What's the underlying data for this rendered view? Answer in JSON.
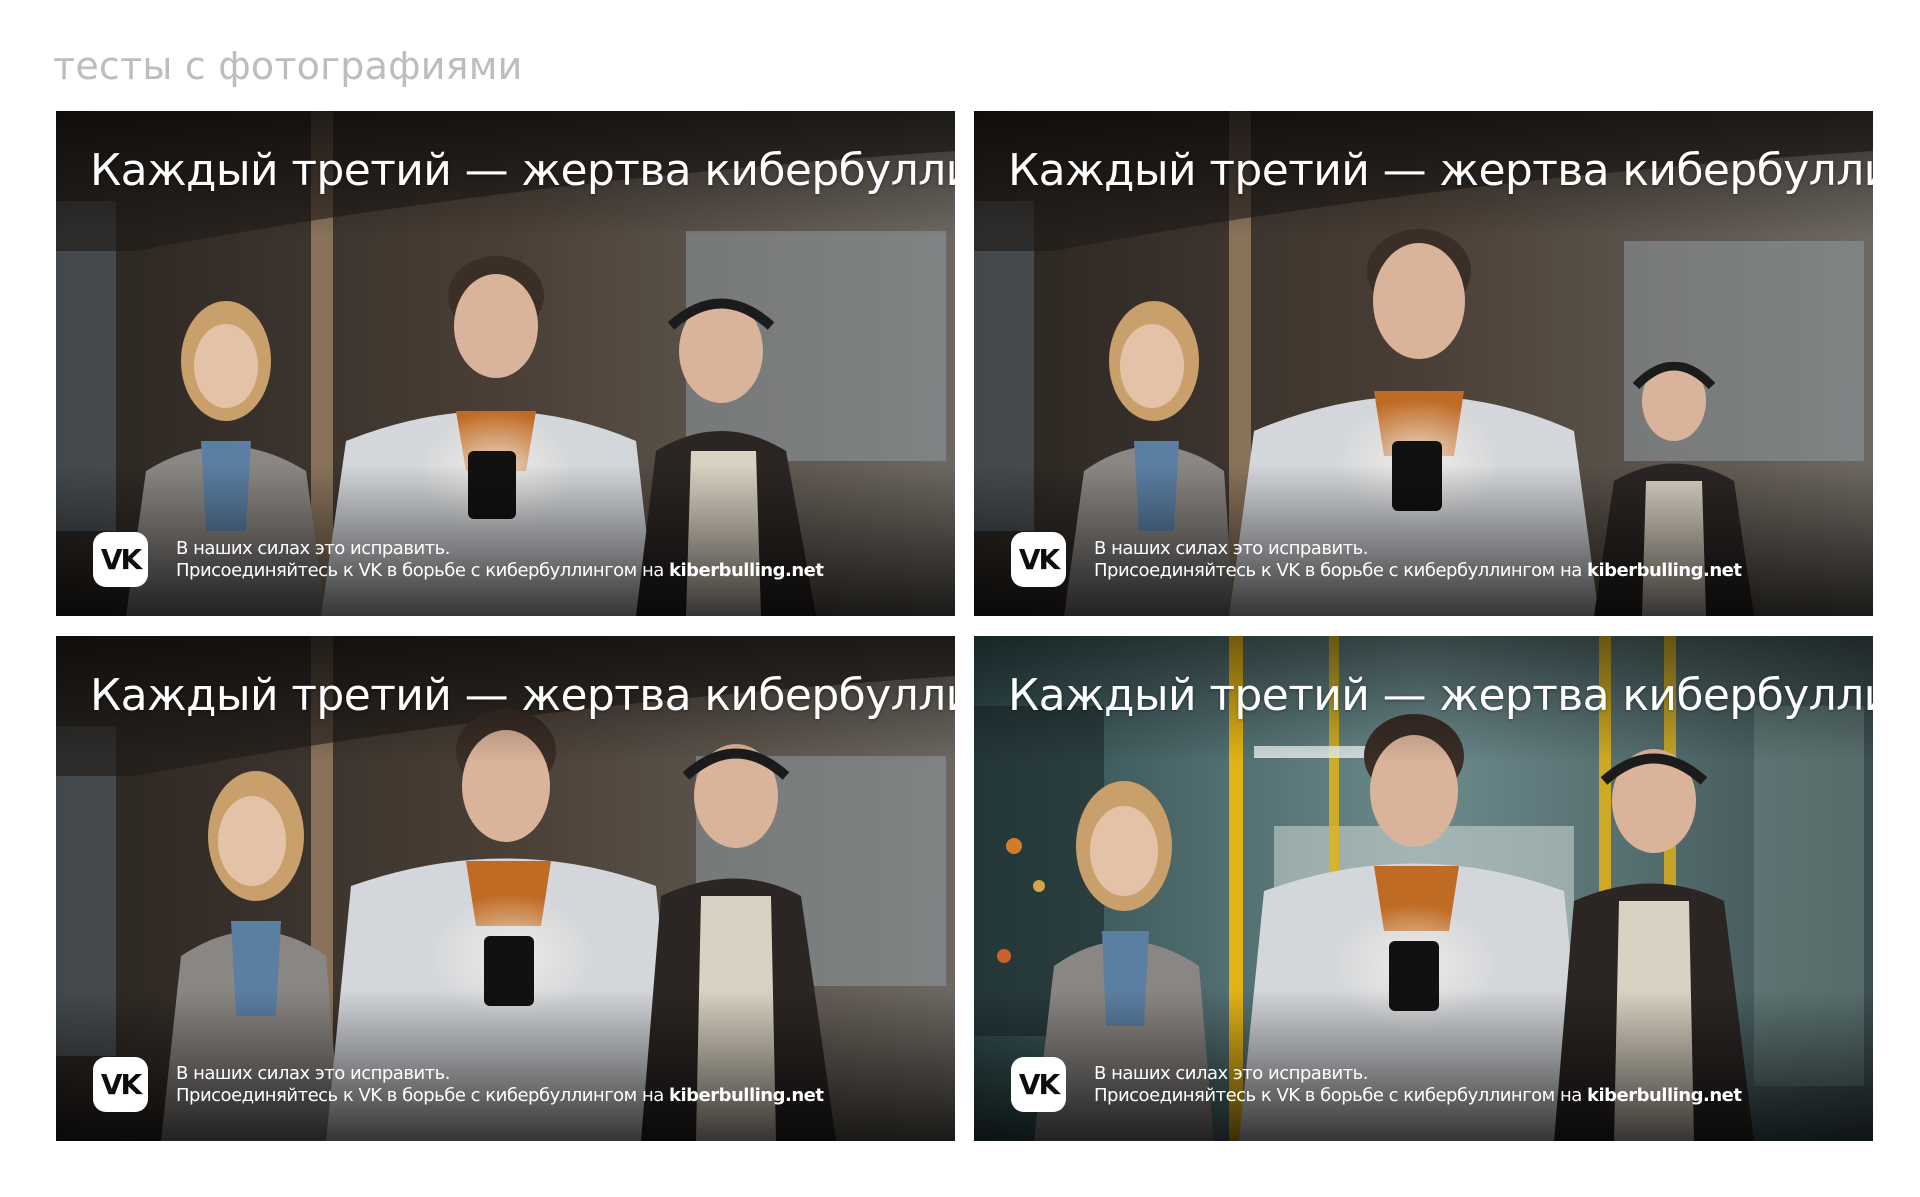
{
  "page": {
    "heading": "тесты с фотографиями"
  },
  "banner": {
    "headline": "Каждый третий — жертва кибербуллинга",
    "logo_text": "VK",
    "cta_line1": "В наших силах это исправить.",
    "cta_line2": "Присоединяйтесь к VK в борьбе с кибербуллингом на ",
    "cta_link": "kiberbulling.net"
  },
  "variants": [
    {
      "name": "photo-test-1",
      "tone": "warm"
    },
    {
      "name": "photo-test-2",
      "tone": "warm"
    },
    {
      "name": "photo-test-3",
      "tone": "warm"
    },
    {
      "name": "photo-test-4",
      "tone": "teal"
    }
  ],
  "colors": {
    "heading": "#bdbdbd",
    "text": "#ffffff",
    "logo_bg": "#ffffff",
    "handrail_yellow": "#e2b316"
  }
}
